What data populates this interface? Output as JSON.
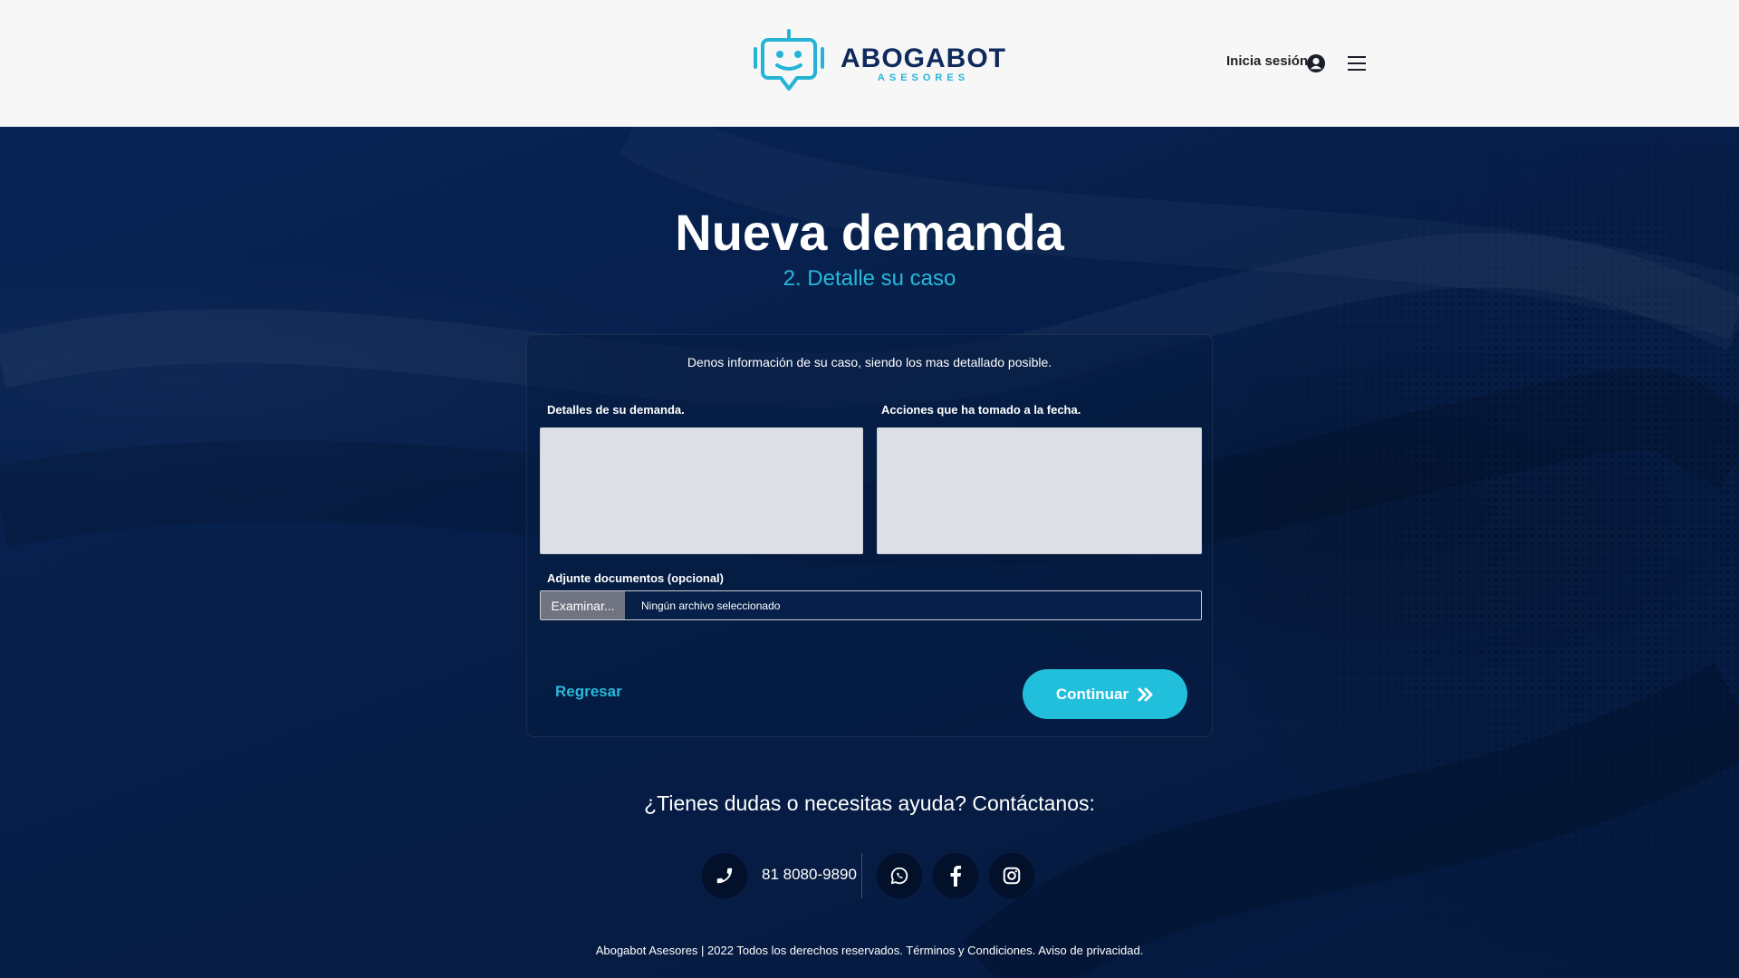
{
  "header": {
    "logo_name": "ABOGABOT",
    "logo_sub": "ASESORES",
    "login_label": "Inicia sesión",
    "user_icon": "user-circle-icon",
    "menu_icon": "hamburger-icon"
  },
  "page": {
    "title": "Nueva demanda",
    "subtitle": "2. Detalle su caso"
  },
  "form": {
    "intro": "Denos información de su caso, siendo los mas detallado posible.",
    "details_label": "Detalles de su demanda.",
    "details_value": "",
    "actions_label": "Acciones que ha tomado a la fecha.",
    "actions_value": "",
    "attach_label": "Adjunte documentos (opcional)",
    "browse_label": "Examinar...",
    "no_file_text": "Ningún archivo seleccionado",
    "back_label": "Regresar",
    "continue_label": "Continuar"
  },
  "contact": {
    "heading": "¿Tienes dudas o necesitas ayuda? Contáctanos:",
    "phone": "81 8080-9890",
    "icons": [
      "phone-icon",
      "whatsapp-icon",
      "facebook-icon",
      "instagram-icon"
    ]
  },
  "footer": {
    "text": "Abogabot Asesores | 2022 Todos los derechos reservados. Términos y Condiciones. Aviso de privacidad."
  },
  "colors": {
    "accent": "#21bfdc",
    "background": "#06204a",
    "header_bg": "#f7f7f7",
    "logo_navy": "#0f2a5c"
  }
}
